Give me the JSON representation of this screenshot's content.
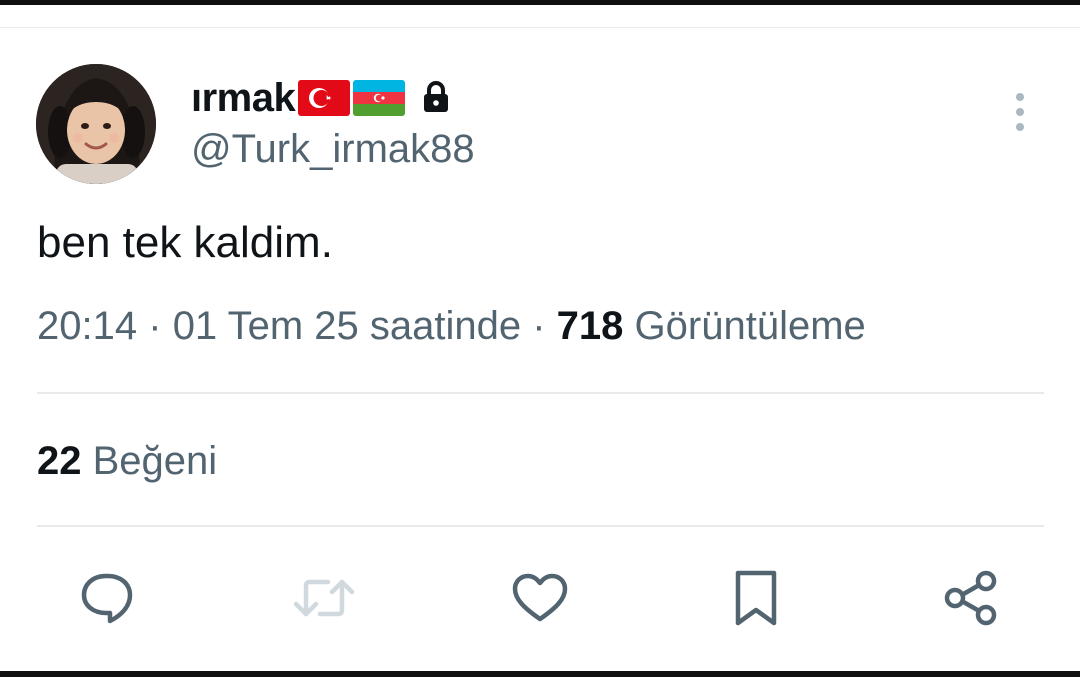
{
  "tweet": {
    "author": {
      "display_name": "ırmak",
      "handle": "@Turk_irmak88",
      "flags": [
        "turkey-flag",
        "azerbaijan-flag"
      ],
      "protected_icon": "lock-icon"
    },
    "text": "ben tek kaldim.",
    "time": "20:14",
    "date_text": "01 Tem 25 saatinde",
    "separator": "·",
    "views_count": "718",
    "views_label": "Görüntüleme",
    "likes_count": "22",
    "likes_label": "Beğeni"
  },
  "actions": [
    {
      "name": "reply",
      "icon": "comment-icon"
    },
    {
      "name": "retweet",
      "icon": "retweet-icon"
    },
    {
      "name": "like",
      "icon": "heart-icon"
    },
    {
      "name": "bookmark",
      "icon": "bookmark-icon"
    },
    {
      "name": "share",
      "icon": "share-icon"
    }
  ],
  "menu_icon": "more-vertical-icon",
  "colors": {
    "primary_text": "#0f1419",
    "secondary_text": "#536471",
    "divider": "#e7e9ea",
    "icon": "#536471",
    "retweet_disabled": "#cfd9de"
  }
}
